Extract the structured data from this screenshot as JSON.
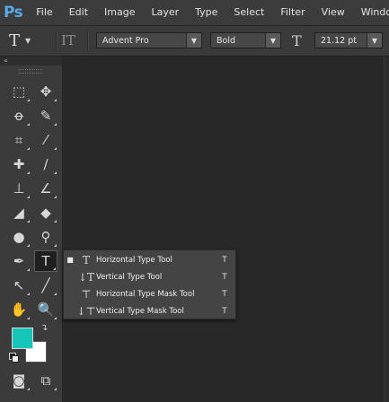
{
  "app": {
    "logo": "Ps"
  },
  "menu": [
    "File",
    "Edit",
    "Image",
    "Layer",
    "Type",
    "Select",
    "Filter",
    "View",
    "Window"
  ],
  "options": {
    "tool_glyph": "T",
    "orientation_glyph": "IT",
    "font_family": "Advent Pro",
    "font_style": "Bold",
    "size_glyph": "T",
    "font_size": "21.12 pt"
  },
  "toolbox": {
    "collapse": "«",
    "tools": [
      {
        "name": "rectangular-marquee-tool",
        "glyph": "⬚"
      },
      {
        "name": "move-tool",
        "glyph": "✥"
      },
      {
        "name": "lasso-tool",
        "glyph": "ꝋ"
      },
      {
        "name": "quick-selection-tool",
        "glyph": "✎"
      },
      {
        "name": "crop-tool",
        "glyph": "⌗"
      },
      {
        "name": "eyedropper-tool",
        "glyph": "⁄"
      },
      {
        "name": "spot-healing-brush-tool",
        "glyph": "✚"
      },
      {
        "name": "brush-tool",
        "glyph": "∕"
      },
      {
        "name": "clone-stamp-tool",
        "glyph": "⊥"
      },
      {
        "name": "history-brush-tool",
        "glyph": "∠"
      },
      {
        "name": "eraser-tool",
        "glyph": "◢"
      },
      {
        "name": "paint-bucket-tool",
        "glyph": "◆"
      },
      {
        "name": "blur-tool",
        "glyph": "●"
      },
      {
        "name": "dodge-tool",
        "glyph": "⚲"
      },
      {
        "name": "pen-tool",
        "glyph": "✒"
      },
      {
        "name": "type-tool",
        "glyph": "T"
      },
      {
        "name": "path-selection-tool",
        "glyph": "↖"
      },
      {
        "name": "line-tool",
        "glyph": "╱"
      },
      {
        "name": "hand-tool",
        "glyph": "✋"
      },
      {
        "name": "zoom-tool",
        "glyph": "🔍"
      },
      {
        "name": "quick-mask-mode",
        "glyph": "◙"
      },
      {
        "name": "screen-mode",
        "glyph": "⧉"
      }
    ],
    "foreground_color": "#17c6b8",
    "background_color": "#ffffff",
    "swap_glyph": "↴"
  },
  "type_flyout": {
    "items": [
      {
        "label": "Horizontal Type Tool",
        "shortcut": "T",
        "icon": "T",
        "selected": true,
        "bullet": "■"
      },
      {
        "label": "Vertical Type Tool",
        "shortcut": "T",
        "icon": "↓T",
        "selected": false,
        "bullet": ""
      },
      {
        "label": "Horizontal Type Mask Tool",
        "shortcut": "T",
        "icon": "⊤",
        "selected": false,
        "bullet": ""
      },
      {
        "label": "Vertical Type Mask Tool",
        "shortcut": "T",
        "icon": "↓⊤",
        "selected": false,
        "bullet": ""
      }
    ]
  }
}
